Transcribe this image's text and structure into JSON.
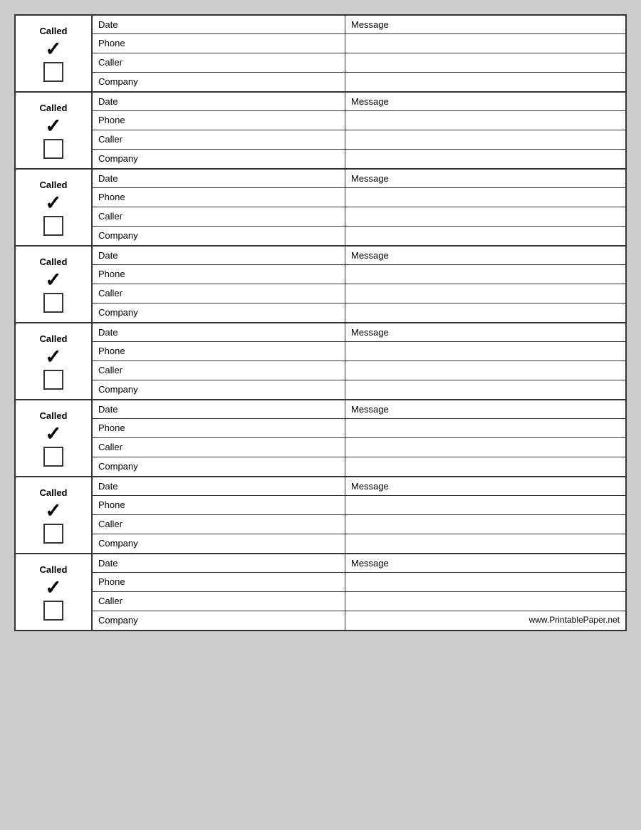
{
  "records": [
    {
      "id": 1
    },
    {
      "id": 2
    },
    {
      "id": 3
    },
    {
      "id": 4
    },
    {
      "id": 5
    },
    {
      "id": 6
    },
    {
      "id": 7
    },
    {
      "id": 8
    }
  ],
  "labels": {
    "called": "Called",
    "date": "Date",
    "phone": "Phone",
    "caller": "Caller",
    "company": "Company",
    "message": "Message",
    "website": "www.PrintablePaper.net"
  }
}
